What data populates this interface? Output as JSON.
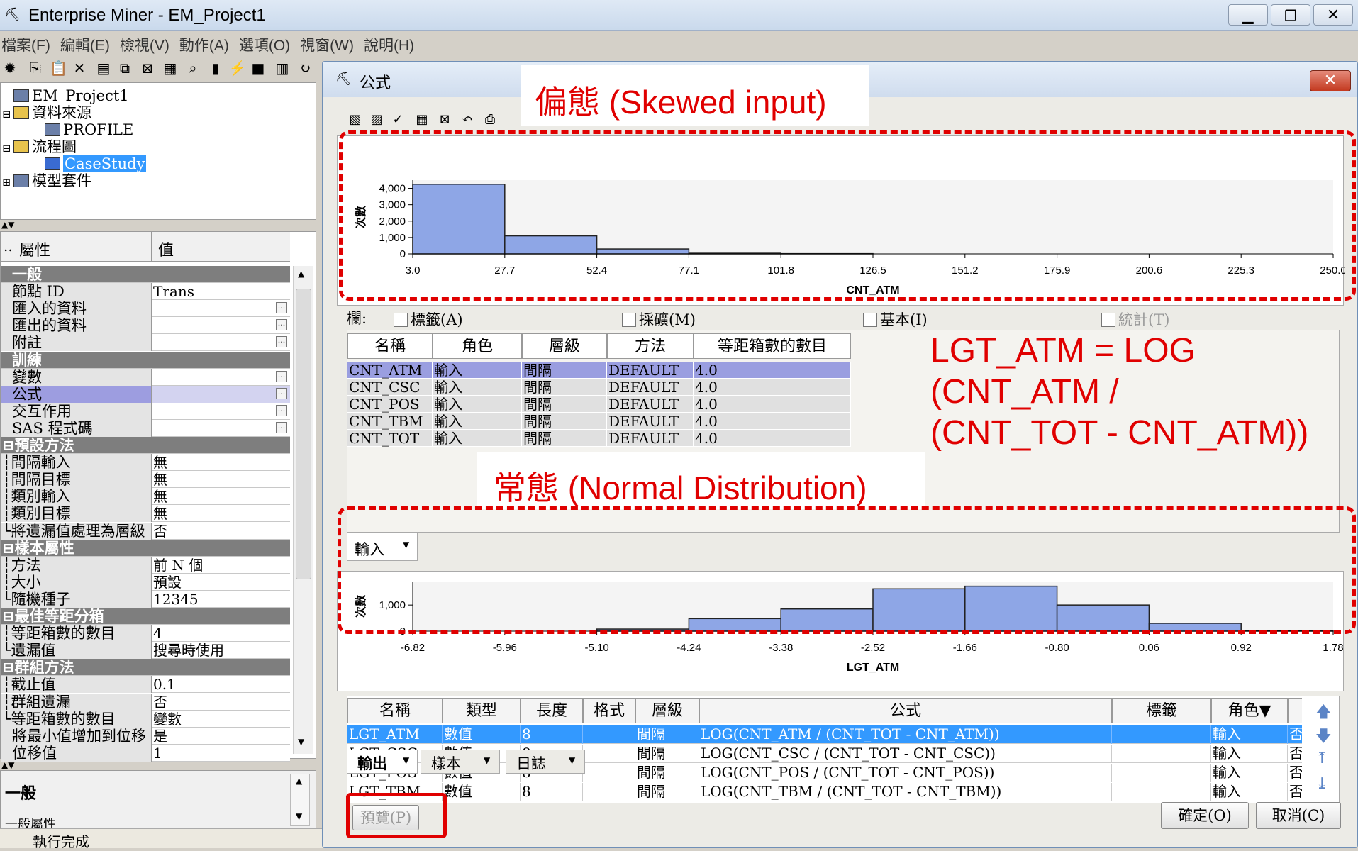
{
  "app": {
    "title": "Enterprise Miner - EM_Project1",
    "window_controls": [
      "minimize-icon",
      "restore-icon",
      "close-icon"
    ]
  },
  "menu": [
    "檔案(F)",
    "編輯(E)",
    "檢視(V)",
    "動作(A)",
    "選項(O)",
    "視窗(W)",
    "說明(H)"
  ],
  "tree": {
    "items": [
      {
        "label": "EM_Project1",
        "icon": "project-icon",
        "expander": ""
      },
      {
        "label": "資料來源",
        "icon": "folder-icon",
        "expander": "⊟"
      },
      {
        "label": "PROFILE",
        "icon": "datasource-icon",
        "expander": ""
      },
      {
        "label": "流程圖",
        "icon": "folder-icon",
        "expander": "⊟"
      },
      {
        "label": "CaseStudy",
        "icon": "diagram-icon",
        "expander": ""
      },
      {
        "label": "模型套件",
        "icon": "package-icon",
        "expander": "⊞"
      }
    ]
  },
  "props": {
    "col_dots": "..",
    "col_prop": "屬性",
    "col_val": "值",
    "rows": [
      {
        "name": "一般",
        "value": "",
        "type": "section",
        "ellipsis": false
      },
      {
        "name": "節點 ID",
        "value": "Trans",
        "type": "row",
        "ellipsis": false
      },
      {
        "name": "匯入的資料",
        "value": "",
        "type": "row",
        "ellipsis": true
      },
      {
        "name": "匯出的資料",
        "value": "",
        "type": "row",
        "ellipsis": true
      },
      {
        "name": "附註",
        "value": "",
        "type": "row",
        "ellipsis": true
      },
      {
        "name": "訓練",
        "value": "",
        "type": "section",
        "ellipsis": false
      },
      {
        "name": "變數",
        "value": "",
        "type": "row",
        "ellipsis": true
      },
      {
        "name": "公式",
        "value": "",
        "type": "selected",
        "ellipsis": true
      },
      {
        "name": "交互作用",
        "value": "",
        "type": "row",
        "ellipsis": true
      },
      {
        "name": "SAS 程式碼",
        "value": "",
        "type": "row",
        "ellipsis": true
      },
      {
        "name": "⊟預設方法",
        "value": "",
        "type": "section",
        "ellipsis": false
      },
      {
        "name": "┆間隔輸入",
        "value": "無",
        "type": "row",
        "ellipsis": false
      },
      {
        "name": "┆間隔目標",
        "value": "無",
        "type": "row",
        "ellipsis": false
      },
      {
        "name": "┆類別輸入",
        "value": "無",
        "type": "row",
        "ellipsis": false
      },
      {
        "name": "┆類別目標",
        "value": "無",
        "type": "row",
        "ellipsis": false
      },
      {
        "name": "└將遺漏值處理為層級",
        "value": "否",
        "type": "row",
        "ellipsis": false
      },
      {
        "name": "⊟樣本屬性",
        "value": "",
        "type": "section",
        "ellipsis": false
      },
      {
        "name": "┆方法",
        "value": "前 N 個",
        "type": "row",
        "ellipsis": false
      },
      {
        "name": "┆大小",
        "value": "預設",
        "type": "row",
        "ellipsis": false
      },
      {
        "name": "└隨機種子",
        "value": "12345",
        "type": "row",
        "ellipsis": false
      },
      {
        "name": "⊟最佳等距分箱",
        "value": "",
        "type": "section",
        "ellipsis": false
      },
      {
        "name": "┆等距箱數的數目",
        "value": "4",
        "type": "row",
        "ellipsis": false
      },
      {
        "name": "└遺漏值",
        "value": "搜尋時使用",
        "type": "row",
        "ellipsis": false
      },
      {
        "name": "⊟群組方法",
        "value": "",
        "type": "section",
        "ellipsis": false
      },
      {
        "name": "┆截止值",
        "value": "0.1",
        "type": "row",
        "ellipsis": false
      },
      {
        "name": "┆群組遺漏",
        "value": "否",
        "type": "row",
        "ellipsis": false
      },
      {
        "name": "└等距箱數的數目",
        "value": "變數",
        "type": "row",
        "ellipsis": false
      },
      {
        "name": "將最小值增加到位移",
        "value": "是",
        "type": "row",
        "ellipsis": false
      },
      {
        "name": "位移值",
        "value": "1",
        "type": "row",
        "ellipsis": false
      }
    ]
  },
  "desc": {
    "title": "一般",
    "subtitle": "一般屬性"
  },
  "status": "執行完成",
  "dialog": {
    "title": "公式",
    "columns_label": "欄:",
    "checks": [
      {
        "label": "標籤(A)",
        "checked": false,
        "enabled": true
      },
      {
        "label": "採礦(M)",
        "checked": false,
        "enabled": true
      },
      {
        "label": "基本(I)",
        "checked": false,
        "enabled": true
      },
      {
        "label": "統計(T)",
        "checked": false,
        "enabled": false
      }
    ],
    "input_table": {
      "headers": [
        "名稱",
        "角色",
        "層級",
        "方法",
        "等距箱數的數目"
      ],
      "rows": [
        [
          "CNT_ATM",
          "輸入",
          "間隔",
          "DEFAULT",
          "4.0"
        ],
        [
          "CNT_CSC",
          "輸入",
          "間隔",
          "DEFAULT",
          "4.0"
        ],
        [
          "CNT_POS",
          "輸入",
          "間隔",
          "DEFAULT",
          "4.0"
        ],
        [
          "CNT_TBM",
          "輸入",
          "間隔",
          "DEFAULT",
          "4.0"
        ],
        [
          "CNT_TOT",
          "輸入",
          "間隔",
          "DEFAULT",
          "4.0"
        ]
      ],
      "selected": 0
    },
    "input_tab": "輸入",
    "output_table": {
      "headers": [
        "名稱",
        "類型",
        "長度",
        "格式",
        "層級",
        "公式",
        "標籤",
        "角色▼",
        "報表"
      ],
      "rows": [
        [
          "LGT_ATM",
          "數值",
          "8",
          "",
          "間隔",
          "LOG(CNT_ATM / (CNT_TOT - CNT_ATM))",
          "",
          "輸入",
          "否"
        ],
        [
          "LGT_CSC",
          "數值",
          "8",
          "",
          "間隔",
          "LOG(CNT_CSC / (CNT_TOT - CNT_CSC))",
          "",
          "輸入",
          "否"
        ],
        [
          "LGT_POS",
          "數值",
          "8",
          "",
          "間隔",
          "LOG(CNT_POS / (CNT_TOT - CNT_POS))",
          "",
          "輸入",
          "否"
        ],
        [
          "LGT_TBM",
          "數值",
          "8",
          "",
          "間隔",
          "LOG(CNT_TBM / (CNT_TOT - CNT_TBM))",
          "",
          "輸入",
          "否"
        ]
      ],
      "selected": 0
    },
    "bottom_tabs": [
      "輸出",
      "樣本",
      "日誌"
    ],
    "preview_button": "預覽(P)",
    "ok_button": "確定(O)",
    "cancel_button": "取消(C)"
  },
  "annotations": {
    "skewed": "偏態 (Skewed input)",
    "normal": "常態 (Normal Distribution)",
    "formula_lines": [
      "LGT_ATM = LOG",
      "(CNT_ATM /",
      "(CNT_TOT - CNT_ATM))"
    ],
    "color": "#e00000"
  },
  "chart_data": [
    {
      "type": "bar",
      "xlabel": "CNT_ATM",
      "ylabel": "次數",
      "ticks": [
        "3.0",
        "27.7",
        "52.4",
        "77.1",
        "101.8",
        "126.5",
        "151.2",
        "175.9",
        "200.6",
        "225.3",
        "250.0"
      ],
      "bins": [
        [
          3.0,
          27.7,
          4250
        ],
        [
          27.7,
          52.4,
          1100
        ],
        [
          52.4,
          77.1,
          300
        ],
        [
          77.1,
          101.8,
          40
        ],
        [
          101.8,
          126.5,
          15
        ]
      ],
      "xlim": [
        3.0,
        250.0
      ],
      "ylim": [
        0,
        4500
      ],
      "yticks": [
        0,
        1000,
        2000,
        3000,
        4000
      ],
      "ytick_labels": [
        "0",
        "1,000",
        "2,000",
        "3,000",
        "4,000"
      ],
      "bar_color": "#8ea6e6"
    },
    {
      "type": "bar",
      "xlabel": "LGT_ATM",
      "ylabel": "次數",
      "ticks": [
        "-6.82",
        "-5.96",
        "-5.10",
        "-4.24",
        "-3.38",
        "-2.52",
        "-1.66",
        "-0.80",
        "0.06",
        "0.92",
        "1.78"
      ],
      "bins": [
        [
          -5.1,
          -4.24,
          80
        ],
        [
          -4.24,
          -3.38,
          480
        ],
        [
          -3.38,
          -2.52,
          850
        ],
        [
          -2.52,
          -1.66,
          1620
        ],
        [
          -1.66,
          -0.8,
          1720
        ],
        [
          -0.8,
          0.06,
          1000
        ],
        [
          0.06,
          0.92,
          300
        ],
        [
          0.92,
          1.78,
          20
        ]
      ],
      "xlim": [
        -6.82,
        1.78
      ],
      "ylim": [
        0,
        1900
      ],
      "yticks": [
        0,
        1000
      ],
      "ytick_labels": [
        "0",
        "1,000"
      ],
      "bar_color": "#8ea6e6"
    }
  ]
}
